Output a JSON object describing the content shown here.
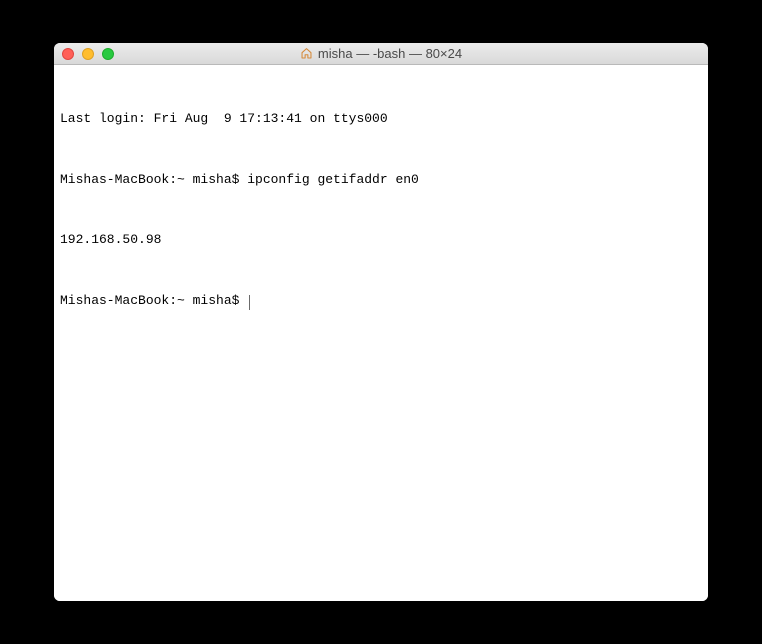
{
  "window": {
    "title": "misha — -bash — 80×24"
  },
  "terminal": {
    "lines": [
      "Last login: Fri Aug  9 17:13:41 on ttys000",
      "Mishas-MacBook:~ misha$ ipconfig getifaddr en0",
      "192.168.50.98",
      "Mishas-MacBook:~ misha$ "
    ]
  }
}
